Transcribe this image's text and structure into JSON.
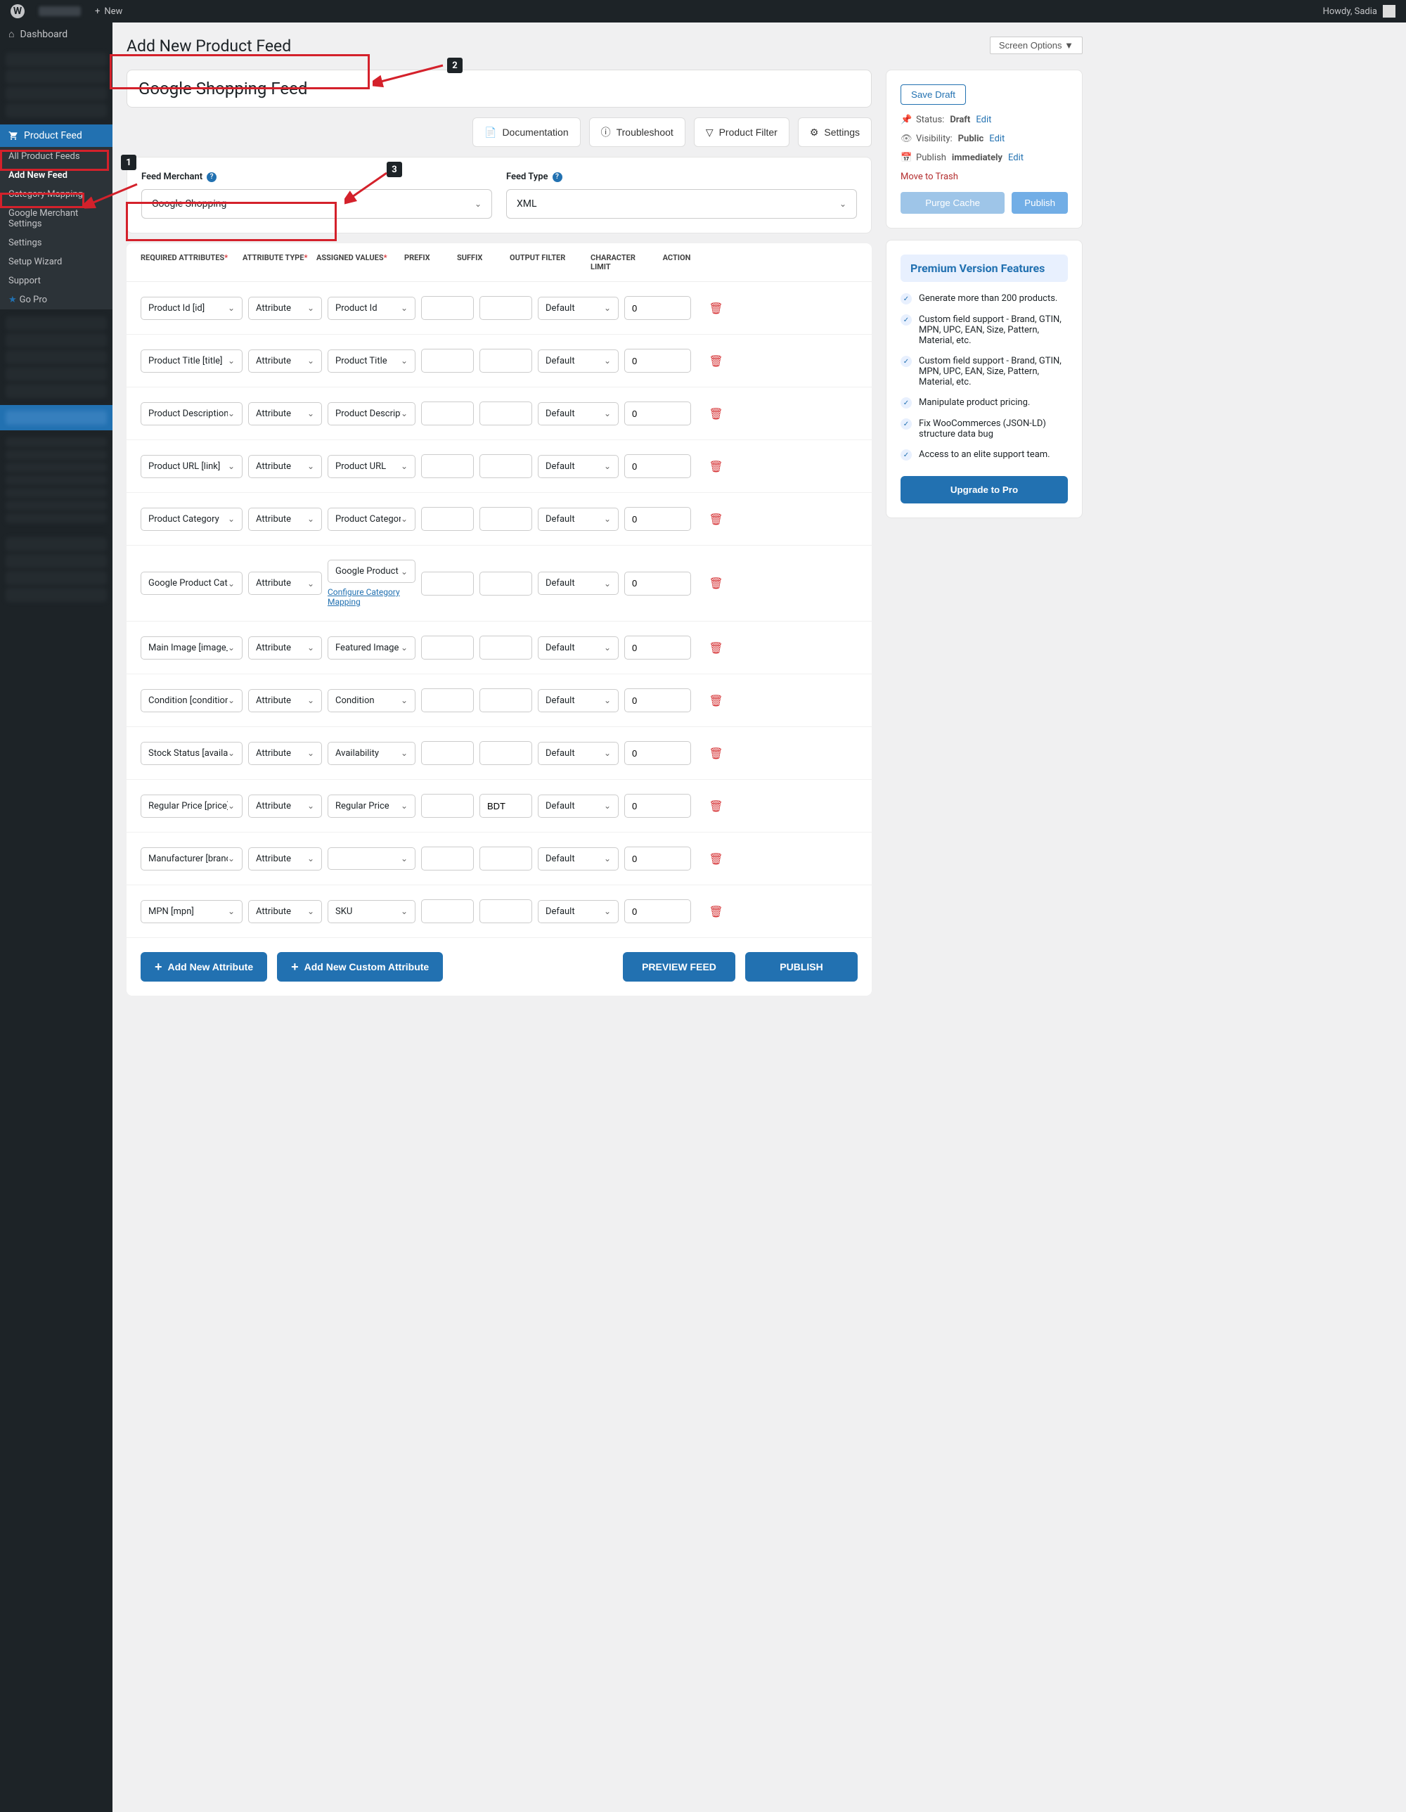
{
  "topbar": {
    "new": "New",
    "howdy": "Howdy, Sadia"
  },
  "sidebar": {
    "dashboard": "Dashboard",
    "product_feed": "Product Feed",
    "subitems": [
      "All Product Feeds",
      "Add New Feed",
      "Category Mapping",
      "Google Merchant Settings",
      "Settings",
      "Setup Wizard",
      "Support",
      "Go Pro"
    ]
  },
  "page": {
    "title": "Add New Product Feed",
    "feed_title": "Google Shopping Feed",
    "screen_options": "Screen Options"
  },
  "toolbar": {
    "documentation": "Documentation",
    "troubleshoot": "Troubleshoot",
    "product_filter": "Product Filter",
    "settings": "Settings"
  },
  "merchant": {
    "label": "Feed Merchant",
    "value": "Google Shopping",
    "type_label": "Feed Type",
    "type_value": "XML"
  },
  "table": {
    "headers": {
      "required": "REQUIRED ATTRIBUTES",
      "type": "ATTRIBUTE TYPE",
      "assigned": "ASSIGNED VALUES",
      "prefix": "PREFIX",
      "suffix": "SUFFIX",
      "filter": "OUTPUT FILTER",
      "limit": "CHARACTER LIMIT",
      "action": "ACTION"
    },
    "rows": [
      {
        "req": "Product Id [id]",
        "type": "Attribute",
        "assigned": "Product Id",
        "prefix": "",
        "suffix": "",
        "filter": "Default",
        "limit": "0"
      },
      {
        "req": "Product Title [title]",
        "type": "Attribute",
        "assigned": "Product Title",
        "prefix": "",
        "suffix": "",
        "filter": "Default",
        "limit": "0"
      },
      {
        "req": "Product Description",
        "type": "Attribute",
        "assigned": "Product Description",
        "prefix": "",
        "suffix": "",
        "filter": "Default",
        "limit": "0"
      },
      {
        "req": "Product URL [link]",
        "type": "Attribute",
        "assigned": "Product URL",
        "prefix": "",
        "suffix": "",
        "filter": "Default",
        "limit": "0"
      },
      {
        "req": "Product Category",
        "type": "Attribute",
        "assigned": "Product Categories",
        "prefix": "",
        "suffix": "",
        "filter": "Default",
        "limit": "0"
      },
      {
        "req": "Google Product Category",
        "type": "Attribute",
        "assigned": "Google Product Category",
        "prefix": "",
        "suffix": "",
        "filter": "Default",
        "limit": "0",
        "config": "Configure Category Mapping"
      },
      {
        "req": "Main Image [image_link]",
        "type": "Attribute",
        "assigned": "Featured Image",
        "prefix": "",
        "suffix": "",
        "filter": "Default",
        "limit": "0"
      },
      {
        "req": "Condition [condition]",
        "type": "Attribute",
        "assigned": "Condition",
        "prefix": "",
        "suffix": "",
        "filter": "Default",
        "limit": "0"
      },
      {
        "req": "Stock Status [availability]",
        "type": "Attribute",
        "assigned": "Availability",
        "prefix": "",
        "suffix": "",
        "filter": "Default",
        "limit": "0"
      },
      {
        "req": "Regular Price [price]",
        "type": "Attribute",
        "assigned": "Regular Price",
        "prefix": "",
        "suffix": "BDT",
        "filter": "Default",
        "limit": "0"
      },
      {
        "req": "Manufacturer [brand]",
        "type": "Attribute",
        "assigned": "",
        "prefix": "",
        "suffix": "",
        "filter": "Default",
        "limit": "0"
      },
      {
        "req": "MPN [mpn]",
        "type": "Attribute",
        "assigned": "SKU",
        "prefix": "",
        "suffix": "",
        "filter": "Default",
        "limit": "0"
      }
    ]
  },
  "buttons": {
    "add_attr": "Add New Attribute",
    "add_custom": "Add New Custom Attribute",
    "preview": "PREVIEW FEED",
    "publish": "PUBLISH"
  },
  "publish_box": {
    "save_draft": "Save Draft",
    "status_label": "Status:",
    "status_value": "Draft",
    "visibility_label": "Visibility:",
    "visibility_value": "Public",
    "publish_label": "Publish",
    "publish_value": "immediately",
    "edit": "Edit",
    "trash": "Move to Trash",
    "purge": "Purge Cache",
    "publish_btn": "Publish"
  },
  "premium": {
    "title": "Premium Version Features",
    "features": [
      "Generate more than 200 products.",
      "Custom field support - Brand, GTIN, MPN, UPC, EAN, Size, Pattern, Material, etc.",
      "Custom field support - Brand, GTIN, MPN, UPC, EAN, Size, Pattern, Material, etc.",
      "Manipulate product pricing.",
      "Fix WooCommerces (JSON-LD) structure data bug",
      "Access to an elite support team."
    ],
    "upgrade": "Upgrade to Pro"
  }
}
